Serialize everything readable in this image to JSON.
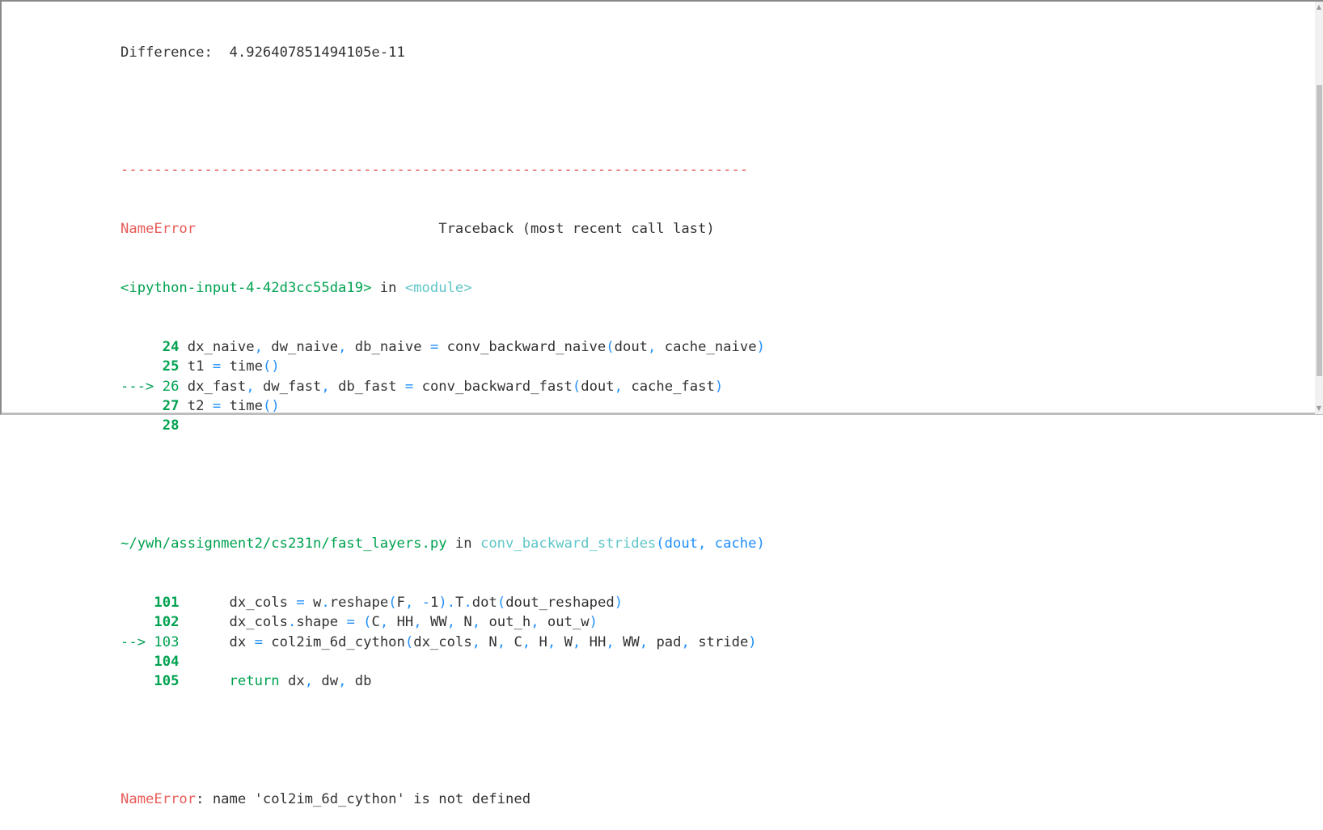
{
  "output": {
    "difference_line": "Difference:  4.926407851494105e-11",
    "separator": "---------------------------------------------------------------------------",
    "error_name": "NameError",
    "traceback_header": "Traceback (most recent call last)",
    "frame1": {
      "location": "<ipython-input-4-42d3cc55da19>",
      "in_word": " in ",
      "module": "<module>",
      "lines": [
        {
          "prefix": "     ",
          "no": "24",
          "code": " dx_naive, dw_naive, db_naive = conv_backward_naive(dout, cache_naive)"
        },
        {
          "prefix": "     ",
          "no": "25",
          "code": " t1 = time()"
        },
        {
          "prefix": "---> ",
          "no": "26",
          "code": " dx_fast, dw_fast, db_fast = conv_backward_fast(dout, cache_fast)"
        },
        {
          "prefix": "     ",
          "no": "27",
          "code": " t2 = time()"
        },
        {
          "prefix": "     ",
          "no": "28",
          "code": ""
        }
      ]
    },
    "frame2": {
      "location": "~/ywh/assignment2/cs231n/fast_layers.py",
      "in_word": " in ",
      "function": "conv_backward_strides",
      "args": "(dout, cache)",
      "lines": [
        {
          "prefix": "    ",
          "no": "101",
          "code": "      dx_cols = w.reshape(F, -1).T.dot(dout_reshaped)"
        },
        {
          "prefix": "    ",
          "no": "102",
          "code": "      dx_cols.shape = (C, HH, WW, N, out_h, out_w)"
        },
        {
          "prefix": "--> ",
          "no": "103",
          "code": "      dx = col2im_6d_cython(dx_cols, N, C, H, W, HH, WW, pad, stride)"
        },
        {
          "prefix": "    ",
          "no": "104",
          "code": ""
        },
        {
          "prefix": "    ",
          "no": "105",
          "code": "      return dx, dw, db"
        }
      ]
    },
    "final_error": {
      "name": "NameError",
      "message": ": name 'col2im_6d_cython' is not defined"
    }
  },
  "colors": {
    "error_red": "#e75c58",
    "lineno_green": "#00a250",
    "module_cyan": "#60c6c8",
    "punct_blue": "#208ffb",
    "text": "#333333"
  },
  "scrollbar": {
    "up_icon": "triangle-up",
    "down_icon": "triangle-down"
  }
}
